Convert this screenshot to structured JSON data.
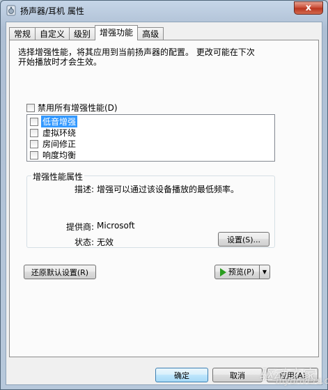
{
  "window": {
    "title": "扬声器/耳机 属性",
    "close_label": "x"
  },
  "tabs": [
    {
      "label": "常规",
      "active": false
    },
    {
      "label": "自定义",
      "active": false
    },
    {
      "label": "级别",
      "active": false
    },
    {
      "label": "增强功能",
      "active": true
    },
    {
      "label": "高级",
      "active": false
    }
  ],
  "enhancements": {
    "description_line1": "选择增强性能，将其应用到当前扬声器的配置。  更改可能在下次",
    "description_line2": "开始播放时才会生效。",
    "disable_all_label": "禁用所有增强性能(D)",
    "items": [
      {
        "label": "低音增强",
        "selected": true,
        "checked": false
      },
      {
        "label": "虚拟环绕",
        "selected": false,
        "checked": false
      },
      {
        "label": "房间修正",
        "selected": false,
        "checked": false
      },
      {
        "label": "响度均衡",
        "selected": false,
        "checked": false
      }
    ]
  },
  "properties": {
    "group_title": "增强性能属性",
    "description_label": "描述:",
    "description_value": "增强可以通过该设备播放的最低频率。",
    "provider_label": "提供商:",
    "provider_value": "Microsoft",
    "status_label": "状态:",
    "status_value": "无效",
    "settings_button": "设置(S)..."
  },
  "buttons": {
    "restore_defaults": "还原默认设置(R)",
    "preview": "预览(P)",
    "ok": "确定",
    "cancel": "取消",
    "apply": "应用(A)"
  },
  "watermark": {
    "brand": "驱动之家",
    "url": "mydrivers.com"
  },
  "colors": {
    "selection": "#3399ff",
    "play_icon": "#2a9d1f",
    "close_button": "#c74a33"
  }
}
